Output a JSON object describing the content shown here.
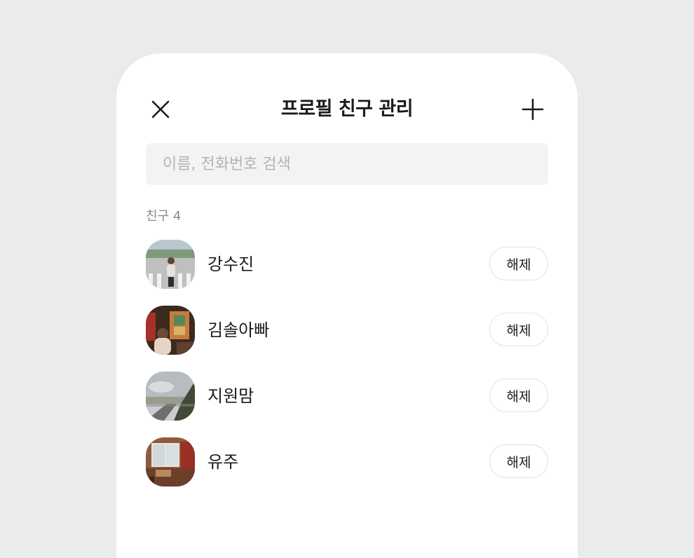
{
  "header": {
    "title": "프로필 친구 관리",
    "close_icon": "close-icon",
    "add_icon": "plus-icon"
  },
  "search": {
    "placeholder": "이름, 전화번호 검색",
    "value": ""
  },
  "friends_section": {
    "label": "친구 4",
    "items": [
      {
        "name": "강수진",
        "action_label": "해제",
        "avatar": "photo-crosswalk"
      },
      {
        "name": "김솔아빠",
        "action_label": "해제",
        "avatar": "photo-indoor-market"
      },
      {
        "name": "지원맘",
        "action_label": "해제",
        "avatar": "photo-sky-street"
      },
      {
        "name": "유주",
        "action_label": "해제",
        "avatar": "photo-window-room"
      }
    ]
  },
  "colors": {
    "background": "#e9ebed",
    "panel": "#ffffff",
    "search_bg": "#f3f3f3",
    "text_primary": "#1c1c1c",
    "text_secondary": "#8a8a8a"
  }
}
